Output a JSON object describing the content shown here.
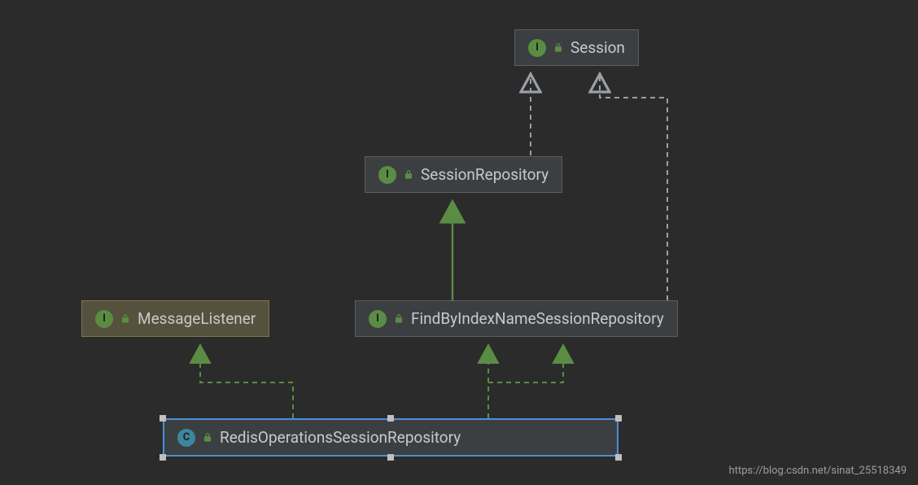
{
  "nodes": {
    "session": {
      "type": "interface",
      "label": "Session"
    },
    "sessionRepository": {
      "type": "interface",
      "label": "SessionRepository"
    },
    "findByIndex": {
      "type": "interface",
      "label": "FindByIndexNameSessionRepository"
    },
    "messageListener": {
      "type": "interface",
      "label": "MessageListener"
    },
    "redisOps": {
      "type": "class",
      "label": "RedisOperationsSessionRepository"
    }
  },
  "badges": {
    "interface": "I",
    "class": "C"
  },
  "watermark": "https://blog.csdn.net/sinat_25518349",
  "colors": {
    "background": "#2b2b2b",
    "nodeFill": "#3c3f41",
    "nodeBorder": "#5e5e5e",
    "highlightFill": "#55513d",
    "selectedBorder": "#4a90d6",
    "interfaceBadge": "#5b8c44",
    "classBadge": "#3e86a0",
    "solidEdge": "#5b8c44",
    "dashedEdge": "#9aa0a6",
    "greenDashed": "#5b8c44"
  },
  "edges": [
    {
      "from": "sessionRepository",
      "to": "session",
      "style": "dashed-gray"
    },
    {
      "from": "findByIndex",
      "to": "session",
      "style": "dashed-gray"
    },
    {
      "from": "findByIndex",
      "to": "sessionRepository",
      "style": "solid-green"
    },
    {
      "from": "redisOps",
      "to": "messageListener",
      "style": "dashed-green"
    },
    {
      "from": "redisOps",
      "to": "findByIndex",
      "style": "dashed-green"
    }
  ]
}
